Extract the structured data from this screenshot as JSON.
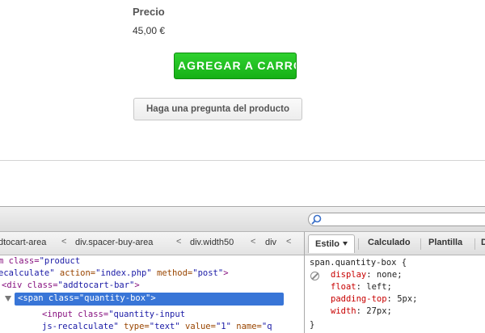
{
  "product": {
    "price_label": "Precio",
    "price_value": "45,00 €",
    "add_to_cart_label": "AGREGAR A CARRO",
    "ask_question_label": "Haga una pregunta del producto"
  },
  "devtools": {
    "breadcrumbs": [
      "dtocart-area",
      "div.spacer-buy-area",
      "div.width50",
      "div"
    ],
    "breadcrumb_separator": "<",
    "sidebar_tabs": [
      "Estilo",
      "Calculado",
      "Plantilla",
      "D"
    ],
    "markup": {
      "line1": {
        "tag_open": "m class=",
        "val": "\"product"
      },
      "line2": {
        "val1": "ecalculate\"",
        "attr": " action=",
        "val2": "\"index.php\"",
        "attr2": " method=",
        "val3": "\"post\"",
        "tag_close": ">"
      },
      "line3": {
        "tag_open": "<div class=",
        "val": "\"addtocart-bar\"",
        "tag_close": ">"
      },
      "line4": {
        "tag_open": "<span class=",
        "val": "\"quantity-box\"",
        "tag_close": ">"
      },
      "line5": {
        "tag_open": "<input class=",
        "val": "\"quantity-input"
      },
      "line6": {
        "val1": "js-recalculate\"",
        "attr": " type=",
        "val2": "\"text\"",
        "attr2": " value=",
        "val3": "\"1\"",
        "attr3": " name=",
        "val4": "\"q"
      }
    },
    "styles": {
      "selector": "span.quantity-box {",
      "rules": [
        {
          "prop": "display",
          "value": " none;"
        },
        {
          "prop": "float",
          "value": " left;"
        },
        {
          "prop": "padding-top",
          "value": " 5px;"
        },
        {
          "prop": "width",
          "value": " 27px;"
        }
      ],
      "close": "}"
    }
  },
  "colors": {
    "add_button": "#1dbf1d",
    "selection": "#3875d7",
    "tag": "#881280",
    "attr": "#994500",
    "value": "#1a1aa6",
    "css_property": "#c80000"
  }
}
